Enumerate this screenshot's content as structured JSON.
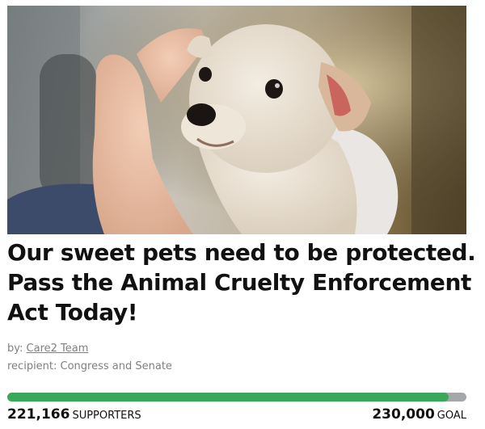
{
  "petition": {
    "title": "Our sweet pets need to be protected. Pass the Animal Cruelty Enforcement Act Today!",
    "by_prefix": "by:",
    "author": "Care2 Team",
    "recipient": "recipient: Congress and Senate"
  },
  "progress": {
    "supporters_count": "221,166",
    "supporters_label": "SUPPORTERS",
    "goal_count": "230,000",
    "goal_label": "GOAL",
    "fraction": 0.9616,
    "fill_color": "#3aa85a",
    "track_color": "#a4a8ab"
  }
}
